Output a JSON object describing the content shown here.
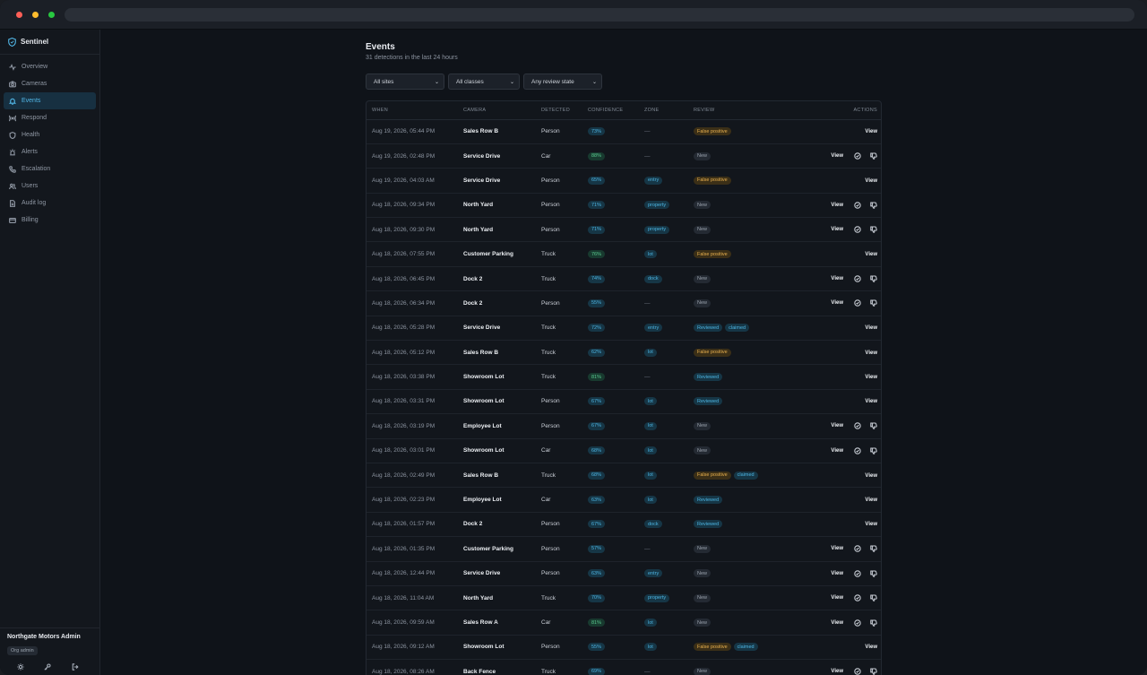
{
  "app": {
    "name": "Sentinel"
  },
  "sidebar": {
    "items": [
      {
        "label": "Overview",
        "icon": "activity-icon"
      },
      {
        "label": "Cameras",
        "icon": "camera-icon"
      },
      {
        "label": "Events",
        "icon": "bell-icon",
        "active": true
      },
      {
        "label": "Respond",
        "icon": "broadcast-icon"
      },
      {
        "label": "Health",
        "icon": "shield-icon"
      },
      {
        "label": "Alerts",
        "icon": "siren-icon"
      },
      {
        "label": "Escalation",
        "icon": "phone-icon"
      },
      {
        "label": "Users",
        "icon": "users-icon"
      },
      {
        "label": "Audit log",
        "icon": "file-icon"
      },
      {
        "label": "Billing",
        "icon": "card-icon"
      }
    ],
    "footer": {
      "org": "Northgate Motors Admin",
      "role": "Org admin"
    }
  },
  "page": {
    "title": "Events",
    "subtitle": "31 detections in the last 24 hours"
  },
  "filters": [
    {
      "value": "All sites"
    },
    {
      "value": "All classes"
    },
    {
      "value": "Any review state"
    }
  ],
  "table": {
    "headers": [
      "WHEN",
      "CAMERA",
      "DETECTED",
      "CONFIDENCE",
      "ZONE",
      "REVIEW",
      "ACTIONS"
    ],
    "view_label": "View",
    "rows": [
      {
        "when": "Aug 19, 2026, 05:44 PM",
        "camera": "Sales Row B",
        "detected": "Person",
        "confidence": "73%",
        "zone": "",
        "review": "False positive",
        "claimed": "",
        "actions": "view"
      },
      {
        "when": "Aug 19, 2026, 02:48 PM",
        "camera": "Service Drive",
        "detected": "Car",
        "confidence": "88%",
        "zone": "",
        "review": "New",
        "claimed": "",
        "actions": "full"
      },
      {
        "when": "Aug 19, 2026, 04:03 AM",
        "camera": "Service Drive",
        "detected": "Person",
        "confidence": "65%",
        "zone": "entry",
        "review": "False positive",
        "claimed": "",
        "actions": "view"
      },
      {
        "when": "Aug 18, 2026, 09:34 PM",
        "camera": "North Yard",
        "detected": "Person",
        "confidence": "71%",
        "zone": "property",
        "review": "New",
        "claimed": "",
        "actions": "full"
      },
      {
        "when": "Aug 18, 2026, 09:30 PM",
        "camera": "North Yard",
        "detected": "Person",
        "confidence": "71%",
        "zone": "property",
        "review": "New",
        "claimed": "",
        "actions": "full"
      },
      {
        "when": "Aug 18, 2026, 07:55 PM",
        "camera": "Customer Parking",
        "detected": "Truck",
        "confidence": "76%",
        "zone": "lot",
        "review": "False positive",
        "claimed": "",
        "actions": "view"
      },
      {
        "when": "Aug 18, 2026, 06:45 PM",
        "camera": "Dock 2",
        "detected": "Truck",
        "confidence": "74%",
        "zone": "dock",
        "review": "New",
        "claimed": "",
        "actions": "full"
      },
      {
        "when": "Aug 18, 2026, 06:34 PM",
        "camera": "Dock 2",
        "detected": "Person",
        "confidence": "55%",
        "zone": "",
        "review": "New",
        "claimed": "",
        "actions": "full"
      },
      {
        "when": "Aug 18, 2026, 05:28 PM",
        "camera": "Service Drive",
        "detected": "Truck",
        "confidence": "72%",
        "zone": "entry",
        "review": "Reviewed",
        "claimed": "claimed",
        "actions": "view"
      },
      {
        "when": "Aug 18, 2026, 05:12 PM",
        "camera": "Sales Row B",
        "detected": "Truck",
        "confidence": "62%",
        "zone": "lot",
        "review": "False positive",
        "claimed": "",
        "actions": "view"
      },
      {
        "when": "Aug 18, 2026, 03:38 PM",
        "camera": "Showroom Lot",
        "detected": "Truck",
        "confidence": "81%",
        "zone": "",
        "review": "Reviewed",
        "claimed": "",
        "actions": "view"
      },
      {
        "when": "Aug 18, 2026, 03:31 PM",
        "camera": "Showroom Lot",
        "detected": "Person",
        "confidence": "67%",
        "zone": "lot",
        "review": "Reviewed",
        "claimed": "",
        "actions": "view"
      },
      {
        "when": "Aug 18, 2026, 03:19 PM",
        "camera": "Employee Lot",
        "detected": "Person",
        "confidence": "67%",
        "zone": "lot",
        "review": "New",
        "claimed": "",
        "actions": "full"
      },
      {
        "when": "Aug 18, 2026, 03:01 PM",
        "camera": "Showroom Lot",
        "detected": "Car",
        "confidence": "68%",
        "zone": "lot",
        "review": "New",
        "claimed": "",
        "actions": "full"
      },
      {
        "when": "Aug 18, 2026, 02:49 PM",
        "camera": "Sales Row B",
        "detected": "Truck",
        "confidence": "68%",
        "zone": "lot",
        "review": "False positive",
        "claimed": "claimed",
        "actions": "view"
      },
      {
        "when": "Aug 18, 2026, 02:23 PM",
        "camera": "Employee Lot",
        "detected": "Car",
        "confidence": "63%",
        "zone": "lot",
        "review": "Reviewed",
        "claimed": "",
        "actions": "view"
      },
      {
        "when": "Aug 18, 2026, 01:57 PM",
        "camera": "Dock 2",
        "detected": "Person",
        "confidence": "67%",
        "zone": "dock",
        "review": "Reviewed",
        "claimed": "",
        "actions": "view"
      },
      {
        "when": "Aug 18, 2026, 01:35 PM",
        "camera": "Customer Parking",
        "detected": "Person",
        "confidence": "57%",
        "zone": "",
        "review": "New",
        "claimed": "",
        "actions": "full"
      },
      {
        "when": "Aug 18, 2026, 12:44 PM",
        "camera": "Service Drive",
        "detected": "Person",
        "confidence": "63%",
        "zone": "entry",
        "review": "New",
        "claimed": "",
        "actions": "full"
      },
      {
        "when": "Aug 18, 2026, 11:04 AM",
        "camera": "North Yard",
        "detected": "Truck",
        "confidence": "70%",
        "zone": "property",
        "review": "New",
        "claimed": "",
        "actions": "full"
      },
      {
        "when": "Aug 18, 2026, 09:59 AM",
        "camera": "Sales Row A",
        "detected": "Car",
        "confidence": "81%",
        "zone": "lot",
        "review": "New",
        "claimed": "",
        "actions": "full"
      },
      {
        "when": "Aug 18, 2026, 09:12 AM",
        "camera": "Showroom Lot",
        "detected": "Person",
        "confidence": "55%",
        "zone": "lot",
        "review": "False positive",
        "claimed": "claimed",
        "actions": "view"
      },
      {
        "when": "Aug 18, 2026, 08:26 AM",
        "camera": "Back Fence",
        "detected": "Truck",
        "confidence": "69%",
        "zone": "",
        "review": "New",
        "claimed": "",
        "actions": "full"
      }
    ]
  },
  "colors": {
    "accent": "#52b8e8",
    "background": "#0f1319",
    "false_positive": "#e8b04f",
    "high_confidence": "#59c98f"
  }
}
